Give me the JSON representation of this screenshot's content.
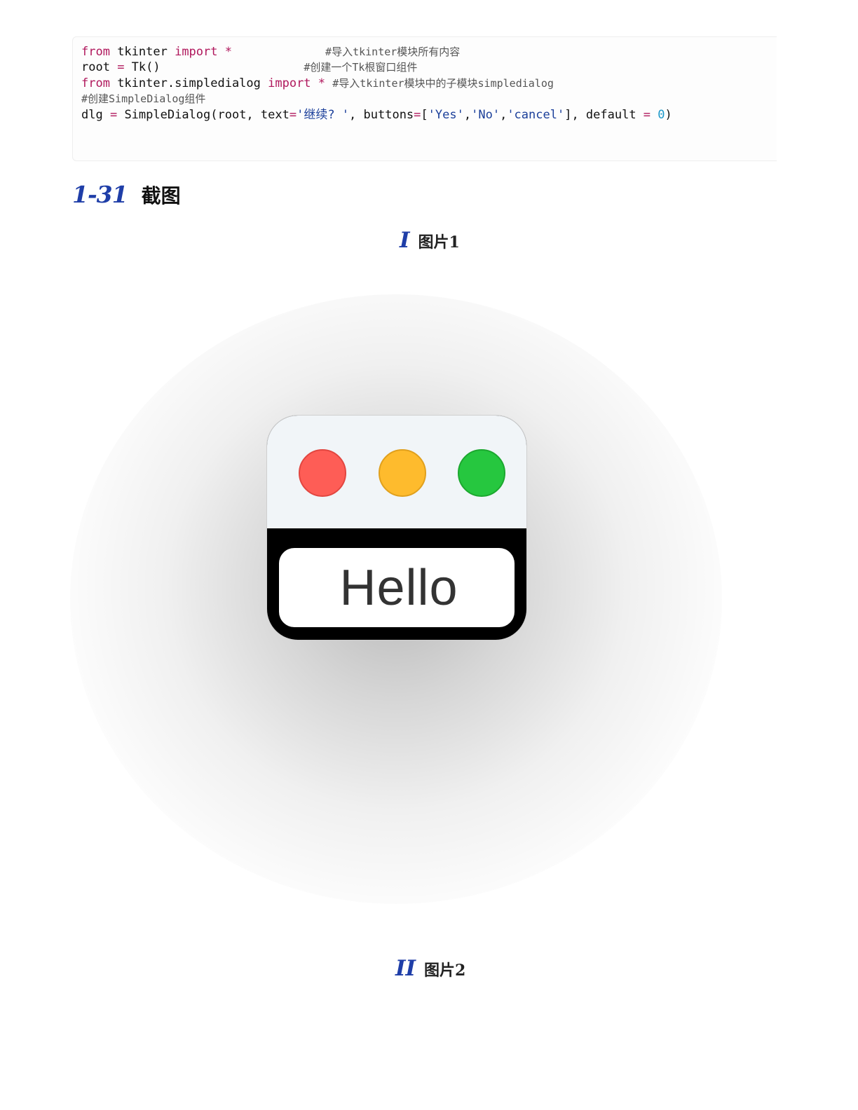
{
  "code": {
    "line1": {
      "kw_from": "from",
      "mod": " tkinter ",
      "kw_import": "import",
      "star": " *",
      "pad": "             ",
      "comment": "#导入tkinter模块所有内容"
    },
    "line2": {
      "var": "root",
      "eq": " = ",
      "call": "Tk()",
      "pad": "                    ",
      "comment": "#创建一个Tk根窗口组件"
    },
    "line3": {
      "kw_from": "from",
      "mod": " tkinter.simpledialog ",
      "kw_import": "import",
      "star": " *",
      "pad": " ",
      "comment": "#导入tkinter模块中的子模块simpledialog"
    },
    "line4": {
      "comment": "#创建SimpleDialog组件"
    },
    "line5": {
      "p1": "dlg",
      "eq1": " = ",
      "p2": "SimpleDialog(root, text",
      "eq2": "=",
      "s1": "'继续? '",
      "p3": ", buttons",
      "eq3": "=",
      "p4": "[",
      "s2": "'Yes'",
      "c1": ",",
      "s3": "'No'",
      "c2": ",",
      "s4": "'cancel'",
      "p5": "], default ",
      "eq4": "=",
      "sp": " ",
      "num": "0",
      "p6": ")"
    }
  },
  "section": {
    "number": "1-31",
    "title": "截图"
  },
  "figure1": {
    "numeral": "I",
    "caption": "图片1"
  },
  "figure2": {
    "numeral": "II",
    "caption": "图片2"
  },
  "window": {
    "button_label": "Hello"
  },
  "colors": {
    "keyword": "#b0175c",
    "string": "#1b3f9a",
    "number": "#1c98c9",
    "accent": "#1f3ea8",
    "close": "#fe5d56",
    "minimize": "#febb2d",
    "zoom": "#26c73f"
  }
}
